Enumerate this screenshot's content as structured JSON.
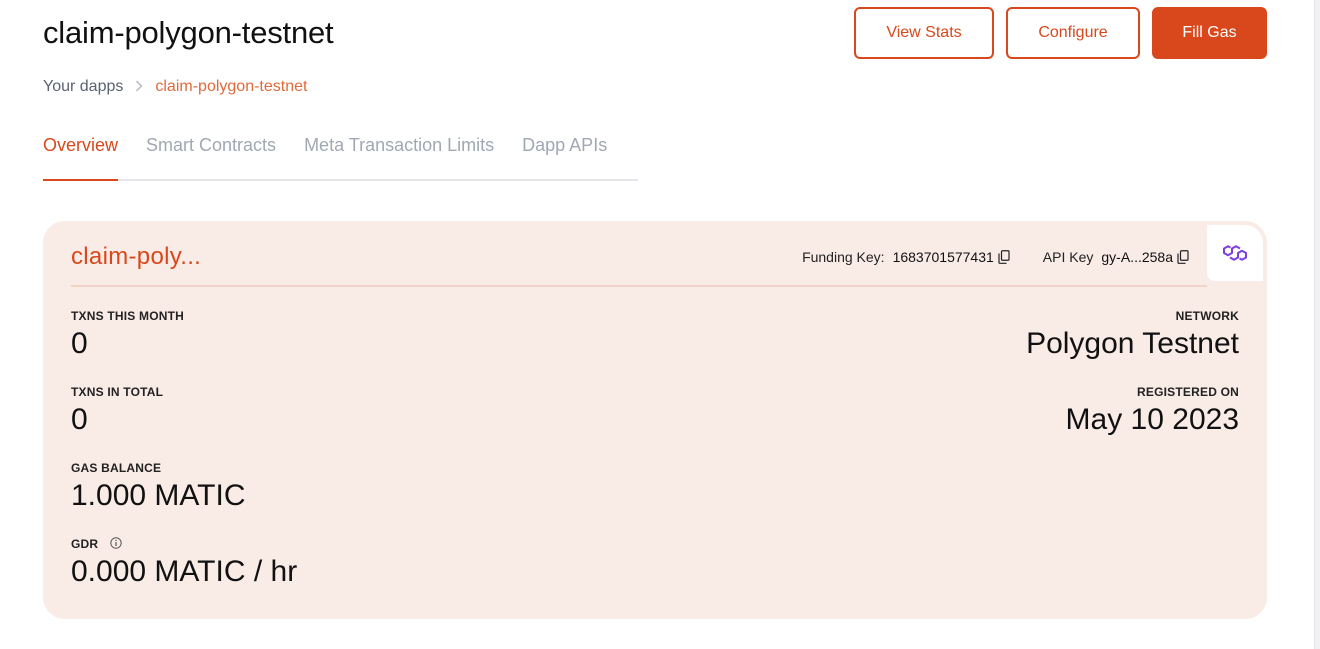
{
  "header": {
    "title": "claim-polygon-testnet",
    "buttons": {
      "view_stats": "View Stats",
      "configure": "Configure",
      "fill_gas": "Fill Gas"
    }
  },
  "breadcrumb": {
    "root": "Your dapps",
    "separator": ">",
    "current": "claim-polygon-testnet"
  },
  "tabs": [
    {
      "label": "Overview",
      "active": true
    },
    {
      "label": "Smart Contracts",
      "active": false
    },
    {
      "label": "Meta Transaction Limits",
      "active": false
    },
    {
      "label": "Dapp APIs",
      "active": false
    }
  ],
  "card": {
    "name": "claim-poly...",
    "funding_key_label": "Funding Key:",
    "funding_key_value": "1683701577431",
    "api_key_label": "API Key",
    "api_key_value": "gy-A...258a",
    "network_icon": "polygon-logo-icon",
    "stats": {
      "txns_this_month": {
        "label": "TXNS THIS MONTH",
        "value": "0"
      },
      "txns_in_total": {
        "label": "TXNS IN TOTAL",
        "value": "0"
      },
      "gas_balance": {
        "label": "GAS BALANCE",
        "value": "1.000 MATIC"
      },
      "gdr": {
        "label": "GDR",
        "value": "0.000 MATIC / hr"
      },
      "network": {
        "label": "NETWORK",
        "value": "Polygon Testnet"
      },
      "registered_on": {
        "label": "REGISTERED ON",
        "value": "May 10 2023"
      }
    }
  },
  "colors": {
    "accent": "#d9481c",
    "accent_light": "#e06a3a",
    "card_bg": "#f9ebe6",
    "polygon_purple": "#7b3fe4",
    "muted_tab": "#a1a8b3"
  }
}
